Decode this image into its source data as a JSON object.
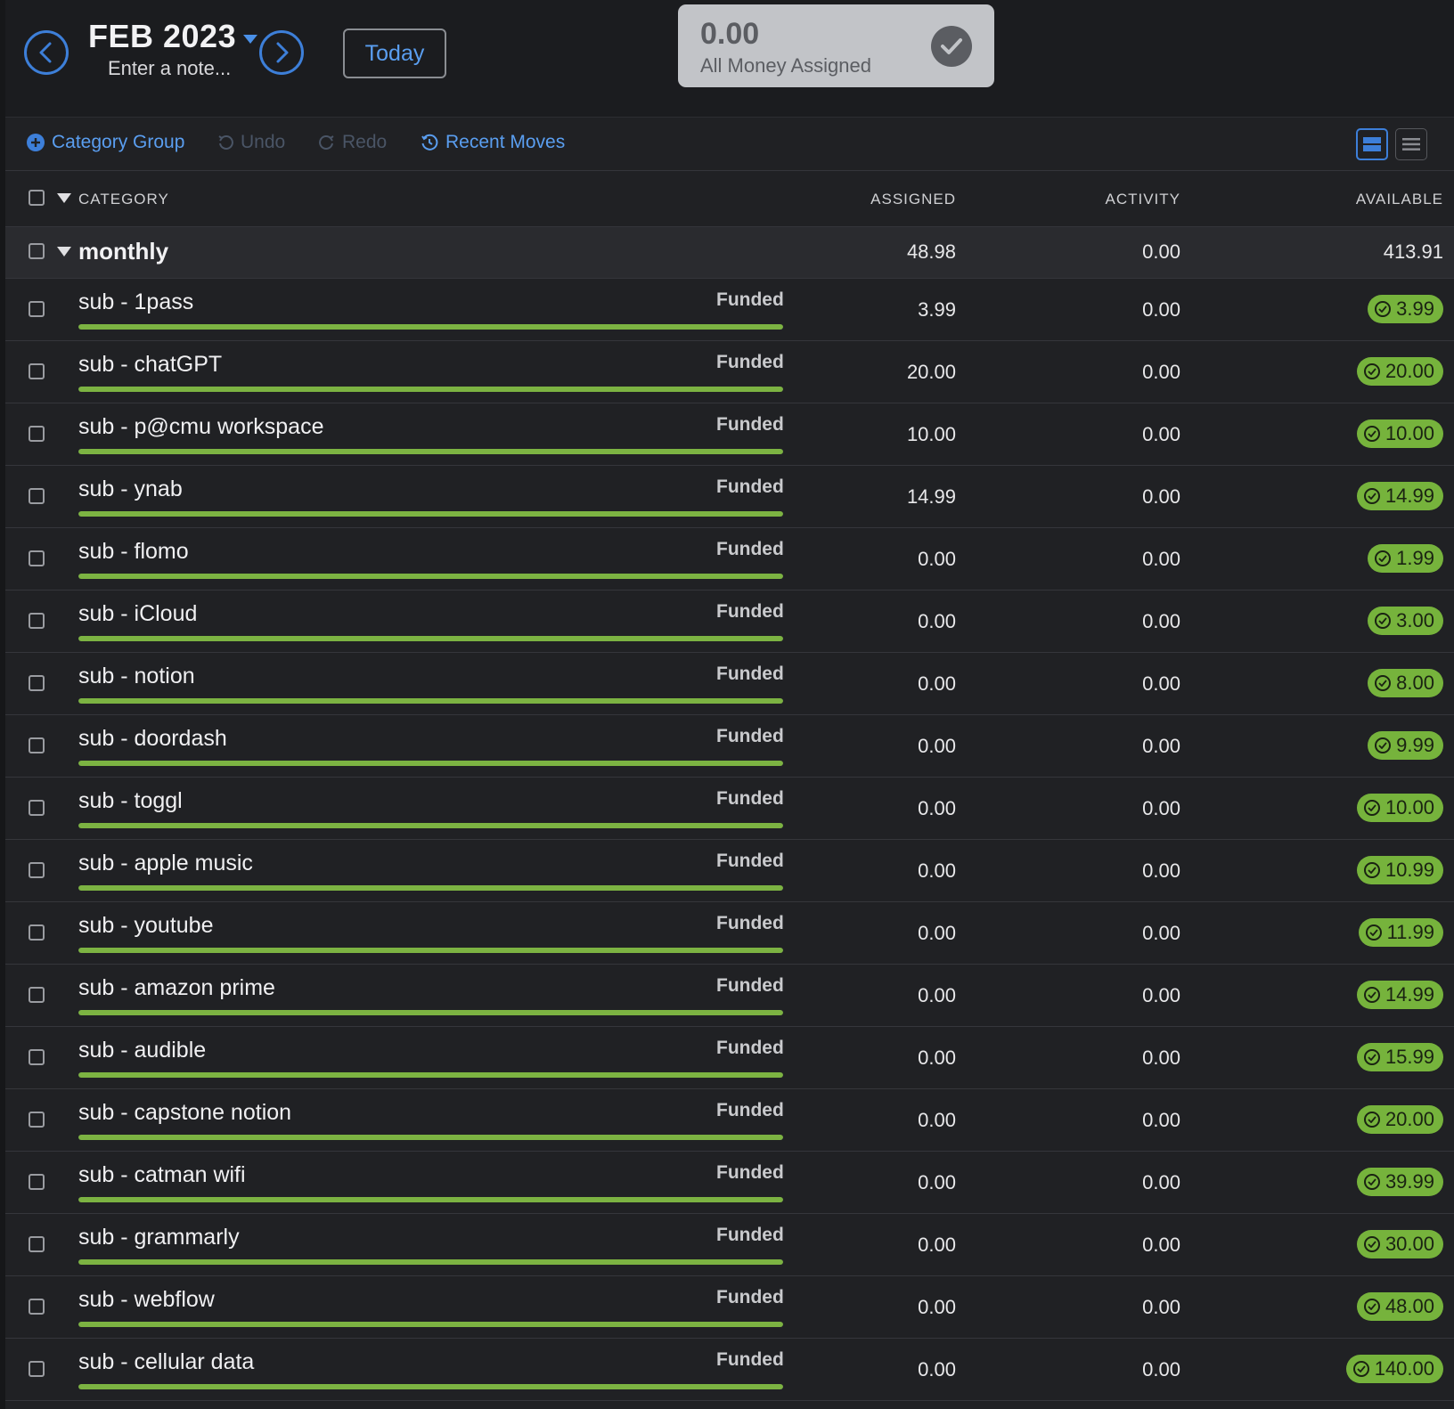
{
  "header": {
    "month": "FEB 2023",
    "note_placeholder": "Enter a note...",
    "today_label": "Today",
    "ready_to_assign": {
      "amount": "0.00",
      "label": "All Money Assigned"
    }
  },
  "toolbar": {
    "category_group": "Category Group",
    "undo": "Undo",
    "redo": "Redo",
    "recent_moves": "Recent Moves"
  },
  "table": {
    "columns": {
      "category": "CATEGORY",
      "assigned": "ASSIGNED",
      "activity": "ACTIVITY",
      "available": "AVAILABLE"
    },
    "group": {
      "name": "monthly",
      "assigned": "48.98",
      "activity": "0.00",
      "available": "413.91"
    },
    "rows": [
      {
        "name": "sub - 1pass",
        "status": "Funded",
        "funded_fraction": 1,
        "assigned": "3.99",
        "activity": "0.00",
        "available": "3.99"
      },
      {
        "name": "sub - chatGPT",
        "status": "Funded",
        "funded_fraction": 1,
        "assigned": "20.00",
        "activity": "0.00",
        "available": "20.00"
      },
      {
        "name": "sub - p@cmu workspace",
        "status": "Funded",
        "funded_fraction": 1,
        "assigned": "10.00",
        "activity": "0.00",
        "available": "10.00"
      },
      {
        "name": "sub - ynab",
        "status": "Funded",
        "funded_fraction": 1,
        "assigned": "14.99",
        "activity": "0.00",
        "available": "14.99"
      },
      {
        "name": "sub - flomo",
        "status": "Funded",
        "funded_fraction": 1,
        "assigned": "0.00",
        "activity": "0.00",
        "available": "1.99"
      },
      {
        "name": "sub - iCloud",
        "status": "Funded",
        "funded_fraction": 1,
        "assigned": "0.00",
        "activity": "0.00",
        "available": "3.00"
      },
      {
        "name": "sub - notion",
        "status": "Funded",
        "funded_fraction": 1,
        "assigned": "0.00",
        "activity": "0.00",
        "available": "8.00"
      },
      {
        "name": "sub - doordash",
        "status": "Funded",
        "funded_fraction": 1,
        "assigned": "0.00",
        "activity": "0.00",
        "available": "9.99"
      },
      {
        "name": "sub - toggl",
        "status": "Funded",
        "funded_fraction": 1,
        "assigned": "0.00",
        "activity": "0.00",
        "available": "10.00"
      },
      {
        "name": "sub - apple music",
        "status": "Funded",
        "funded_fraction": 1,
        "assigned": "0.00",
        "activity": "0.00",
        "available": "10.99"
      },
      {
        "name": "sub - youtube",
        "status": "Funded",
        "funded_fraction": 1,
        "assigned": "0.00",
        "activity": "0.00",
        "available": "11.99"
      },
      {
        "name": "sub - amazon prime",
        "status": "Funded",
        "funded_fraction": 1,
        "assigned": "0.00",
        "activity": "0.00",
        "available": "14.99"
      },
      {
        "name": "sub - audible",
        "status": "Funded",
        "funded_fraction": 1,
        "assigned": "0.00",
        "activity": "0.00",
        "available": "15.99"
      },
      {
        "name": "sub - capstone notion",
        "status": "Funded",
        "funded_fraction": 1,
        "assigned": "0.00",
        "activity": "0.00",
        "available": "20.00"
      },
      {
        "name": "sub - catman wifi",
        "status": "Funded",
        "funded_fraction": 1,
        "assigned": "0.00",
        "activity": "0.00",
        "available": "39.99"
      },
      {
        "name": "sub - grammarly",
        "status": "Funded",
        "funded_fraction": 1,
        "assigned": "0.00",
        "activity": "0.00",
        "available": "30.00"
      },
      {
        "name": "sub - webflow",
        "status": "Funded",
        "funded_fraction": 1,
        "assigned": "0.00",
        "activity": "0.00",
        "available": "48.00"
      },
      {
        "name": "sub - cellular data",
        "status": "Funded",
        "funded_fraction": 1,
        "assigned": "0.00",
        "activity": "0.00",
        "available": "140.00"
      }
    ]
  },
  "colors": {
    "accent": "#3d7fd9",
    "funded": "#76b33c",
    "background": "#202124"
  },
  "icons": {
    "prev": "chevron-left-icon",
    "next": "chevron-right-icon",
    "assigned_status": "check-icon",
    "add": "plus-circle-icon",
    "undo": "undo-icon",
    "redo": "redo-icon",
    "recent": "history-icon",
    "view_expanded": "view-expanded-icon",
    "view_compact": "view-compact-icon"
  }
}
